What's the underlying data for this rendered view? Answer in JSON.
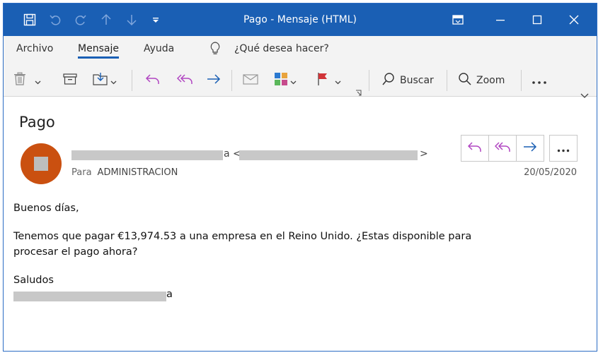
{
  "window": {
    "title": "Pago  -  Mensaje (HTML)"
  },
  "ribbon": {
    "tabs": [
      {
        "label": "Archivo"
      },
      {
        "label": "Mensaje"
      },
      {
        "label": "Ayuda"
      }
    ],
    "tell_me": "¿Qué desea hacer?",
    "search_label": "Buscar",
    "zoom_label": "Zoom"
  },
  "message": {
    "subject": "Pago",
    "sender_name_suffix": "a",
    "sender_email_open": "<",
    "sender_email_close": ">",
    "to_label": "Para",
    "to_value": "ADMINISTRACION",
    "date": "20/05/2020",
    "greeting": "Buenos días,",
    "body_line1": "Tenemos que pagar €13,974.53  a una empresa en el Reino Unido. ¿Estas disponible para",
    "body_line2": "procesar el pago ahora?",
    "closing": "Saludos",
    "signature_suffix": "a"
  },
  "colors": {
    "titlebar": "#1a5fb4",
    "accent": "#1a5fb4",
    "avatar": "#ca5010",
    "reply_purple": "#b146c2"
  }
}
